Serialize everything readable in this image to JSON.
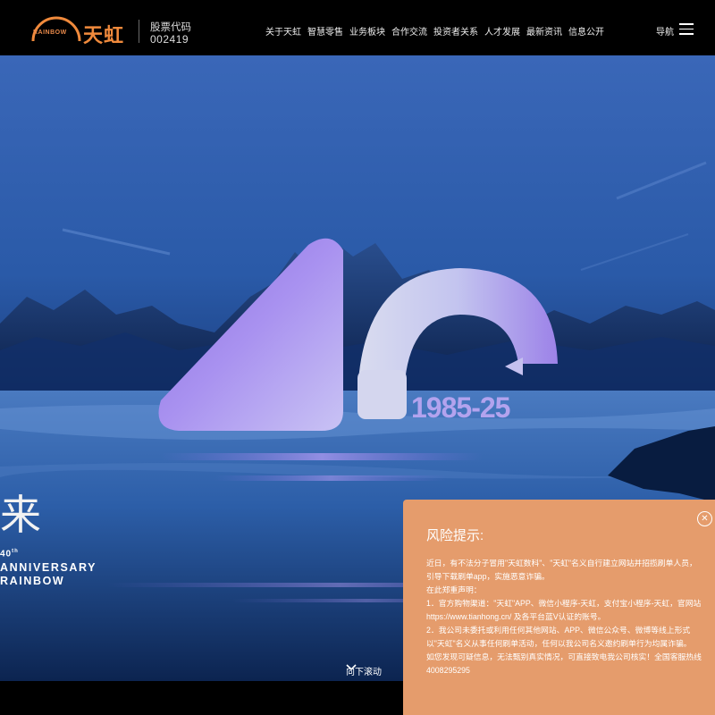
{
  "header": {
    "logo_text": "天虹",
    "logo_word": "RAINBOW",
    "stock_label": "股票代码",
    "stock_code": "002419",
    "nav": [
      "关于天虹",
      "智慧零售",
      "业务板块",
      "合作交流",
      "投资者关系",
      "人才发展",
      "最新资讯",
      "信息公开"
    ],
    "guide_label": "导航",
    "brand_color": "#f08a3c"
  },
  "hero": {
    "number": "40",
    "years": "1985-25",
    "headline_cn": "来",
    "ann_40": "40",
    "ann_40_suffix": "th",
    "anniversary": "ANNIVERSARY",
    "rainbow": "RAINBOW",
    "scroll_label": "向下滚动"
  },
  "risk": {
    "title": "风险提示:",
    "close_icon": "close-icon",
    "lines": [
      "近日，有不法分子冒用\"天虹数科\"、\"天虹\"名义自行建立网站并招揽刷单人员，引导下载刷单app，实施恶意诈骗。",
      "在此郑重声明：",
      "1．官方购物渠道：\"天虹\"APP、微信小程序-天虹，支付宝小程序-天虹，官网站https://www.tianhong.cn/ 及各平台蓝V认证的账号。",
      "2．我公司未委托或利用任何其他网站、APP、微信公众号、微博等线上形式以\"天虹\"名义从事任何刷单活动，任何以我公司名义邀约刷单行为均属诈骗。",
      "如您发现可疑信息，无法甄别真实情况，可直接致电我公司核实！全国客服热线4008295295"
    ],
    "bg_color": "#e59c6c"
  }
}
